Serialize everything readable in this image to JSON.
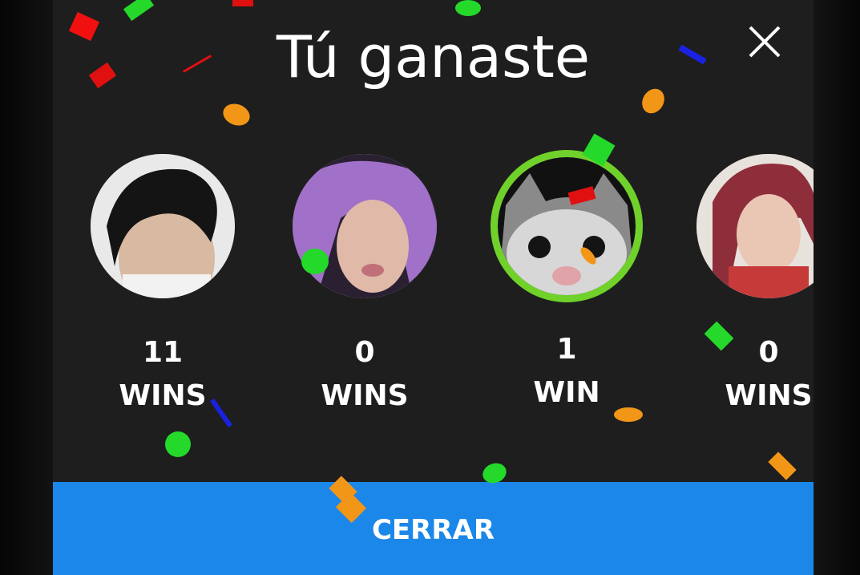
{
  "dialog": {
    "title": "Tú ganaste",
    "close_icon": "close-icon",
    "close_button_label": "CERRAR"
  },
  "players": [
    {
      "count": "11",
      "unit": "WINS",
      "winner": false
    },
    {
      "count": "0",
      "unit": "WINS",
      "winner": false
    },
    {
      "count": "1",
      "unit": "WIN",
      "winner": true
    },
    {
      "count": "0",
      "unit": "WINS",
      "winner": false
    }
  ],
  "colors": {
    "dialog_background": "#1e1e1e",
    "button": "#1b87e8",
    "winner_ring": "#6fd12a",
    "text": "#ffffff"
  }
}
